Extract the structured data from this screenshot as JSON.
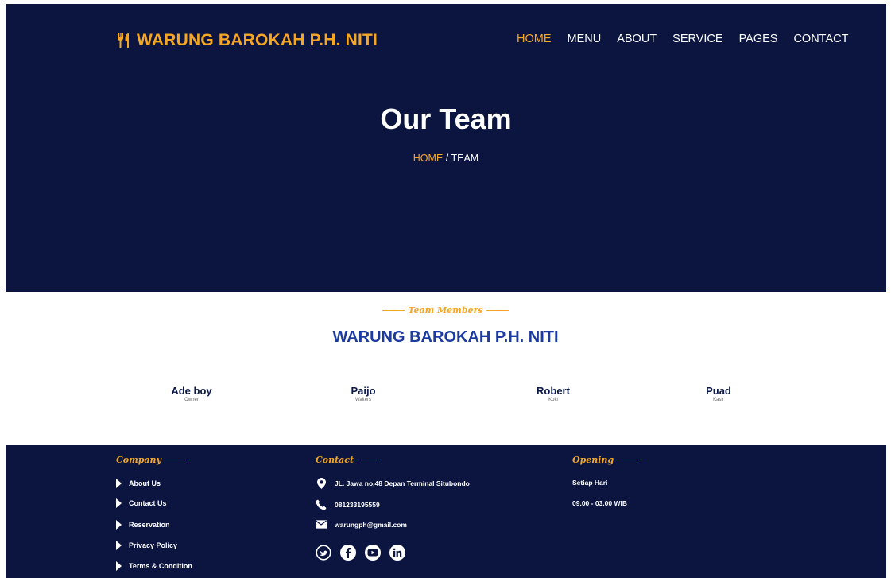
{
  "header": {
    "brand": "WARUNG BAROKAH P.H. NITI",
    "nav": [
      "HOME",
      "MENU",
      "ABOUT",
      "SERVICE",
      "PAGES",
      "CONTACT"
    ],
    "active_nav": "HOME"
  },
  "hero": {
    "title": "Our Team",
    "breadcrumb_home": "HOME",
    "breadcrumb_separator": " / ",
    "breadcrumb_current": "TEAM"
  },
  "team": {
    "subtitle": "Team Members",
    "title": "WARUNG BAROKAH P.H. NITI",
    "members": [
      {
        "name": "Ade boy",
        "role": "Owner"
      },
      {
        "name": "Paijo",
        "role": "Waiters"
      },
      {
        "name": "Robert",
        "role": "Koki"
      },
      {
        "name": "Puad",
        "role": "Kasir"
      }
    ]
  },
  "footer": {
    "company": {
      "heading": "Company",
      "links": [
        "About Us",
        "Contact Us",
        "Reservation",
        "Privacy Policy",
        "Terms & Condition"
      ]
    },
    "contact": {
      "heading": "Contact",
      "address": "JL. Jawa no.48 Depan Terminal Situbondo",
      "phone": "081233195559",
      "email": "warungph@gmail.com",
      "address_icon": "map-pin-icon",
      "phone_icon": "phone-icon",
      "email_icon": "envelope-icon",
      "socials": [
        "twitter-icon",
        "facebook-icon",
        "youtube-icon",
        "linkedin-icon"
      ]
    },
    "opening": {
      "heading": "Opening",
      "days": "Setiap Hari",
      "hours": "09.00 - 03.00 WIB"
    }
  },
  "colors": {
    "navy": "#0b1540",
    "accent": "#f5a623",
    "title_blue": "#1c3aa0"
  }
}
